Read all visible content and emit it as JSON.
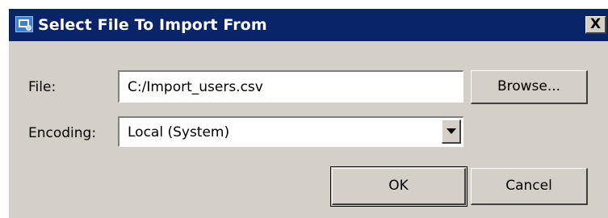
{
  "window": {
    "title": "Select File To Import From",
    "close_label": "X"
  },
  "form": {
    "file_label": "File:",
    "file_value": "C:/Import_users.csv",
    "browse_label": "Browse...",
    "encoding_label": "Encoding:",
    "encoding_value": "Local (System)"
  },
  "actions": {
    "ok_label": "OK",
    "cancel_label": "Cancel"
  }
}
